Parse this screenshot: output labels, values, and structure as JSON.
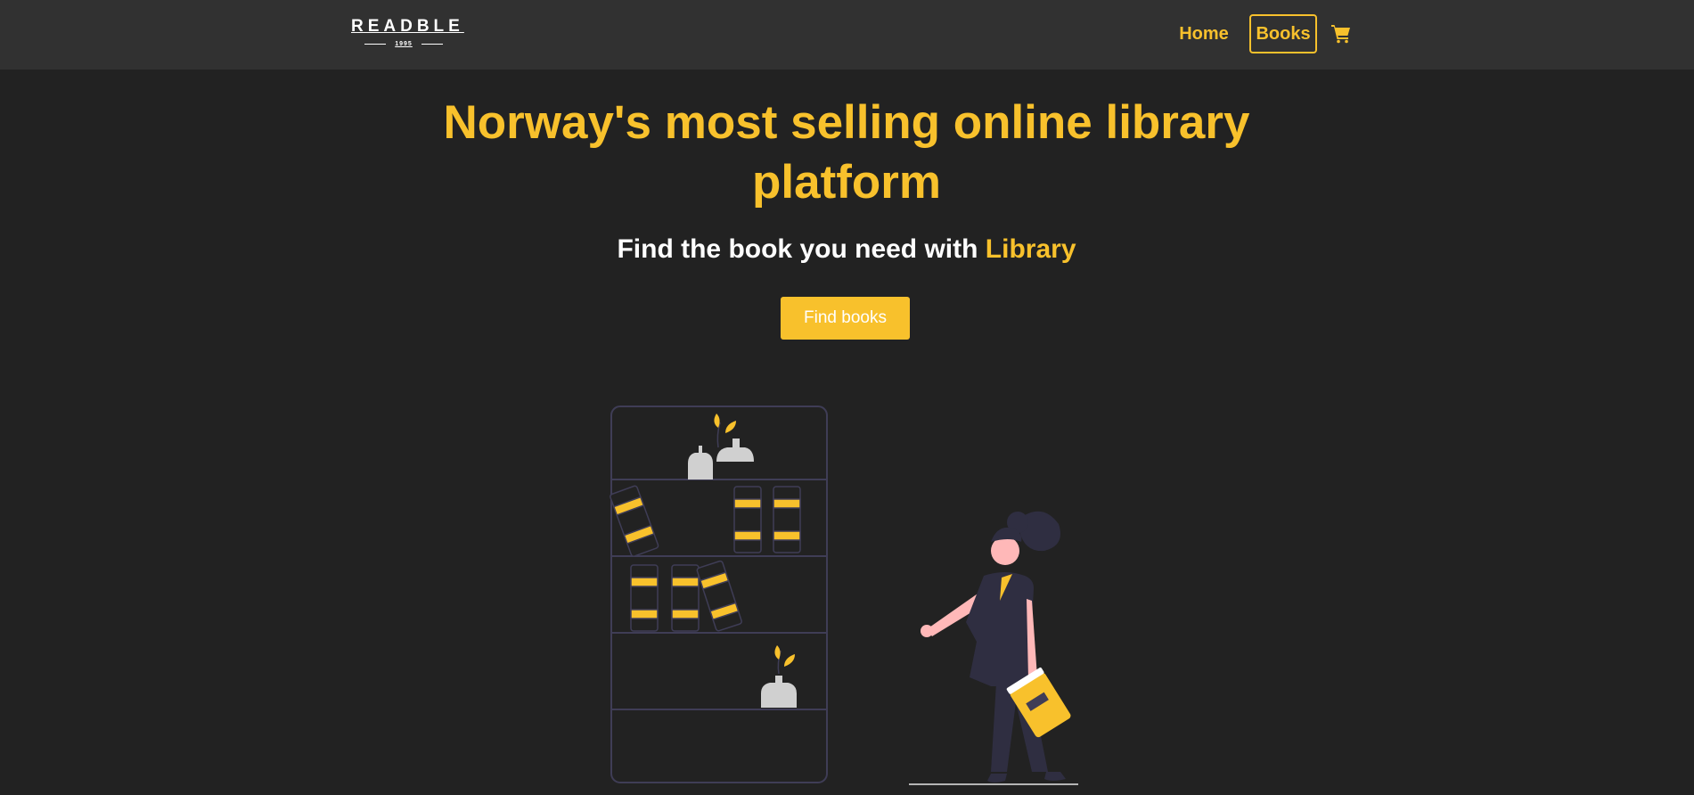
{
  "brand": {
    "name": "READBLE",
    "year": "1995"
  },
  "nav": {
    "home_label": "Home",
    "books_label": "Books",
    "cart_icon": "cart-icon"
  },
  "hero": {
    "title": "Norway's most selling online library platform",
    "subtitle_prefix": "Find the book you need with ",
    "subtitle_accent": "Library",
    "cta_label": "Find books"
  },
  "colors": {
    "background": "#222222",
    "navbar": "#313131",
    "accent": "#f8c12c",
    "text": "#ffffff"
  }
}
